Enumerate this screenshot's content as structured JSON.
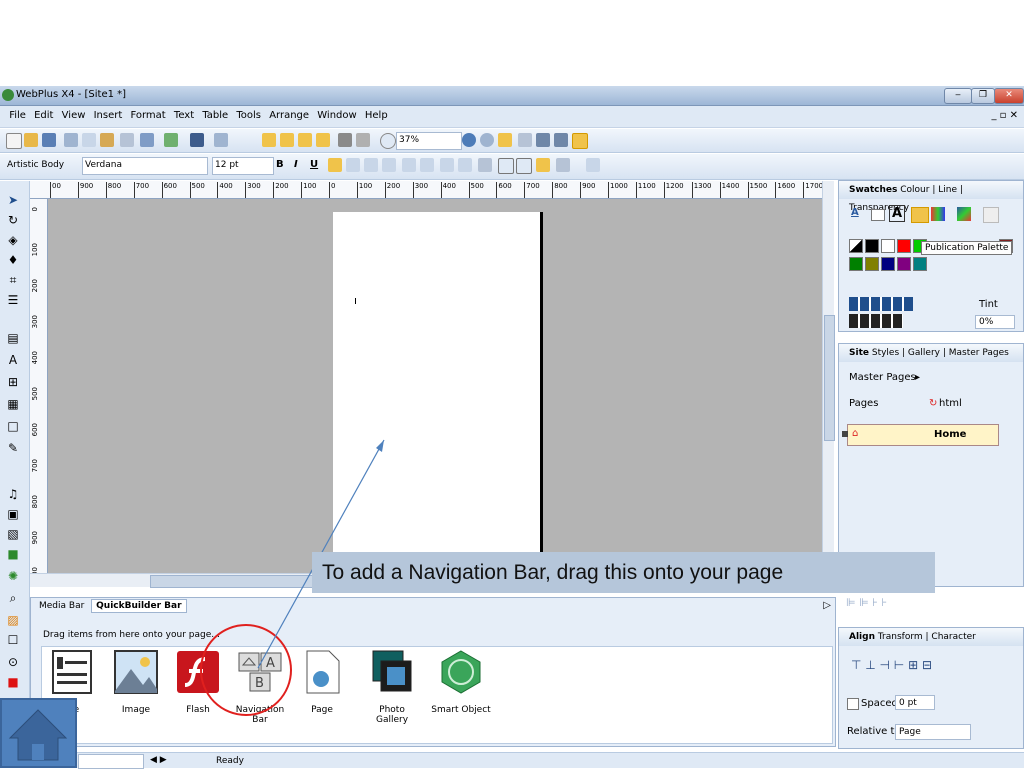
{
  "window": {
    "title": "WebPlus X4 - [Site1 *]"
  },
  "menu": [
    "File",
    "Edit",
    "View",
    "Insert",
    "Format",
    "Text",
    "Table",
    "Tools",
    "Arrange",
    "Window",
    "Help"
  ],
  "toolbar": {
    "zoom": "37%"
  },
  "format_bar": {
    "style": "Artistic Body",
    "font": "Verdana",
    "size": "12 pt",
    "bold": "B",
    "italic": "I",
    "underline": "U"
  },
  "ruler": {
    "h_ticks": [
      "00",
      "900",
      "800",
      "700",
      "600",
      "500",
      "400",
      "300",
      "200",
      "100",
      "0",
      "100",
      "200",
      "300",
      "400",
      "500",
      "600",
      "700",
      "800",
      "900",
      "1000",
      "1100",
      "1200",
      "1300",
      "1400",
      "1500",
      "1600",
      "1700"
    ],
    "v_ticks": [
      "0",
      "100",
      "200",
      "300",
      "400",
      "500",
      "600",
      "700",
      "800",
      "900",
      "1000"
    ]
  },
  "quickbar": {
    "tabs": [
      "Media Bar",
      "QuickBuilder Bar"
    ],
    "hint": "Drag items from here onto your page...",
    "items": [
      "me",
      "Image",
      "Flash",
      "Navigation Bar",
      "Page",
      "Photo Gallery",
      "Smart Object"
    ]
  },
  "swatches_panel": {
    "tabs": [
      "Swatches",
      "Colour",
      "Line",
      "Transparency"
    ],
    "tooltip": "Publication Palette",
    "tint_label": "Tint",
    "tint_value": "0%",
    "colors": [
      "#000000",
      "#ffffff",
      "#ff0000",
      "#00cc00",
      "#7f1f1f",
      "#008000",
      "#808000",
      "#000080",
      "#800080",
      "#008080"
    ]
  },
  "site_panel": {
    "tabs": [
      "Site",
      "Styles",
      "Gallery",
      "Master Pages"
    ],
    "master_pages_label": "Master Pages",
    "pages_label": "Pages",
    "html_label": "html",
    "home_page": "Home"
  },
  "align_panel": {
    "tabs": [
      "Align",
      "Transform",
      "Character"
    ],
    "spaced_label": "Spaced",
    "spaced_value": "0 pt",
    "relative_label": "Relative to:",
    "relative_value": "Page"
  },
  "status": {
    "text": "Ready"
  },
  "callout": {
    "text": "To add a Navigation Bar, drag this onto your page"
  },
  "accent": "#4f81bd"
}
